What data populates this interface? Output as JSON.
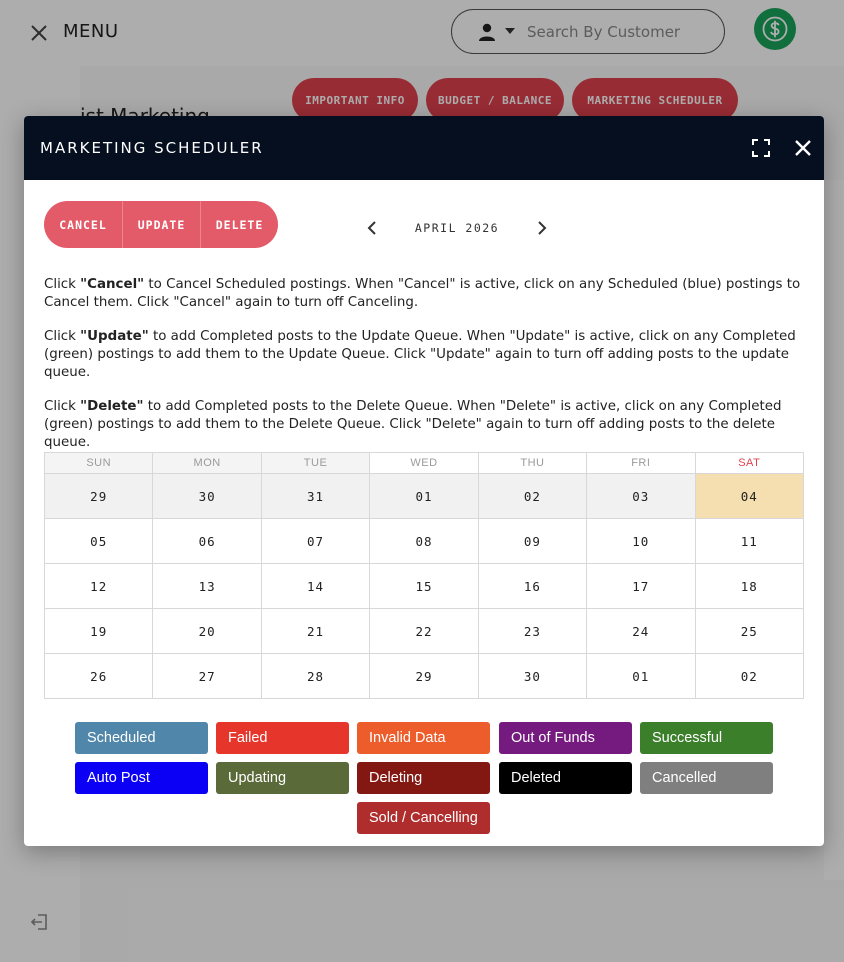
{
  "topbar": {
    "menu_label": "MENU",
    "search_placeholder": "Search By Customer"
  },
  "background": {
    "heading": "ist Marketing",
    "tabs": [
      "IMPORTANT INFO",
      "BUDGET / BALANCE",
      "MARKETING SCHEDULER"
    ]
  },
  "modal": {
    "title": "MARKETING SCHEDULER",
    "actions": [
      "CANCEL",
      "UPDATE",
      "DELETE"
    ],
    "month": "APRIL 2026",
    "instructions": [
      {
        "keyword": "\"Cancel\"",
        "pre": "Click ",
        "post": " to Cancel Scheduled postings. When \"Cancel\" is active, click on any Scheduled (blue) postings to Cancel them. Click \"Cancel\" again to turn off Canceling."
      },
      {
        "keyword": "\"Update\"",
        "pre": "Click ",
        "post": " to add Completed posts to the Update Queue. When \"Update\" is active, click on any Completed (green) postings to add them to the Update Queue. Click \"Update\" again to turn off adding posts to the update queue."
      },
      {
        "keyword": "\"Delete\"",
        "pre": "Click ",
        "post": " to add Completed posts to the Delete Queue. When \"Delete\" is active, click on any Completed (green) postings to add them to the Delete Queue. Click \"Delete\" again to turn off adding posts to the delete queue."
      }
    ],
    "weekdays": [
      "SUN",
      "MON",
      "TUE",
      "WED",
      "THU",
      "FRI",
      "SAT"
    ],
    "weeks": [
      [
        "29",
        "30",
        "31",
        "01",
        "02",
        "03",
        "04"
      ],
      [
        "05",
        "06",
        "07",
        "08",
        "09",
        "10",
        "11"
      ],
      [
        "12",
        "13",
        "14",
        "15",
        "16",
        "17",
        "18"
      ],
      [
        "19",
        "20",
        "21",
        "22",
        "23",
        "24",
        "25"
      ],
      [
        "26",
        "27",
        "28",
        "29",
        "30",
        "01",
        "02"
      ]
    ],
    "legend": [
      {
        "label": "Scheduled",
        "color": "#4f86aa"
      },
      {
        "label": "Failed",
        "color": "#e6352b"
      },
      {
        "label": "Invalid Data",
        "color": "#ec5d2b"
      },
      {
        "label": "Out of Funds",
        "color": "#751a7f"
      },
      {
        "label": "Successful",
        "color": "#3b7f2a"
      },
      {
        "label": "Auto Post",
        "color": "#0b00f5"
      },
      {
        "label": "Updating",
        "color": "#5a6a38"
      },
      {
        "label": "Deleting",
        "color": "#821811"
      },
      {
        "label": "Deleted",
        "color": "#000000"
      },
      {
        "label": "Cancelled",
        "color": "#7f7f7f"
      },
      {
        "label": "Sold / Cancelling",
        "color": "#b02d2d"
      }
    ]
  }
}
